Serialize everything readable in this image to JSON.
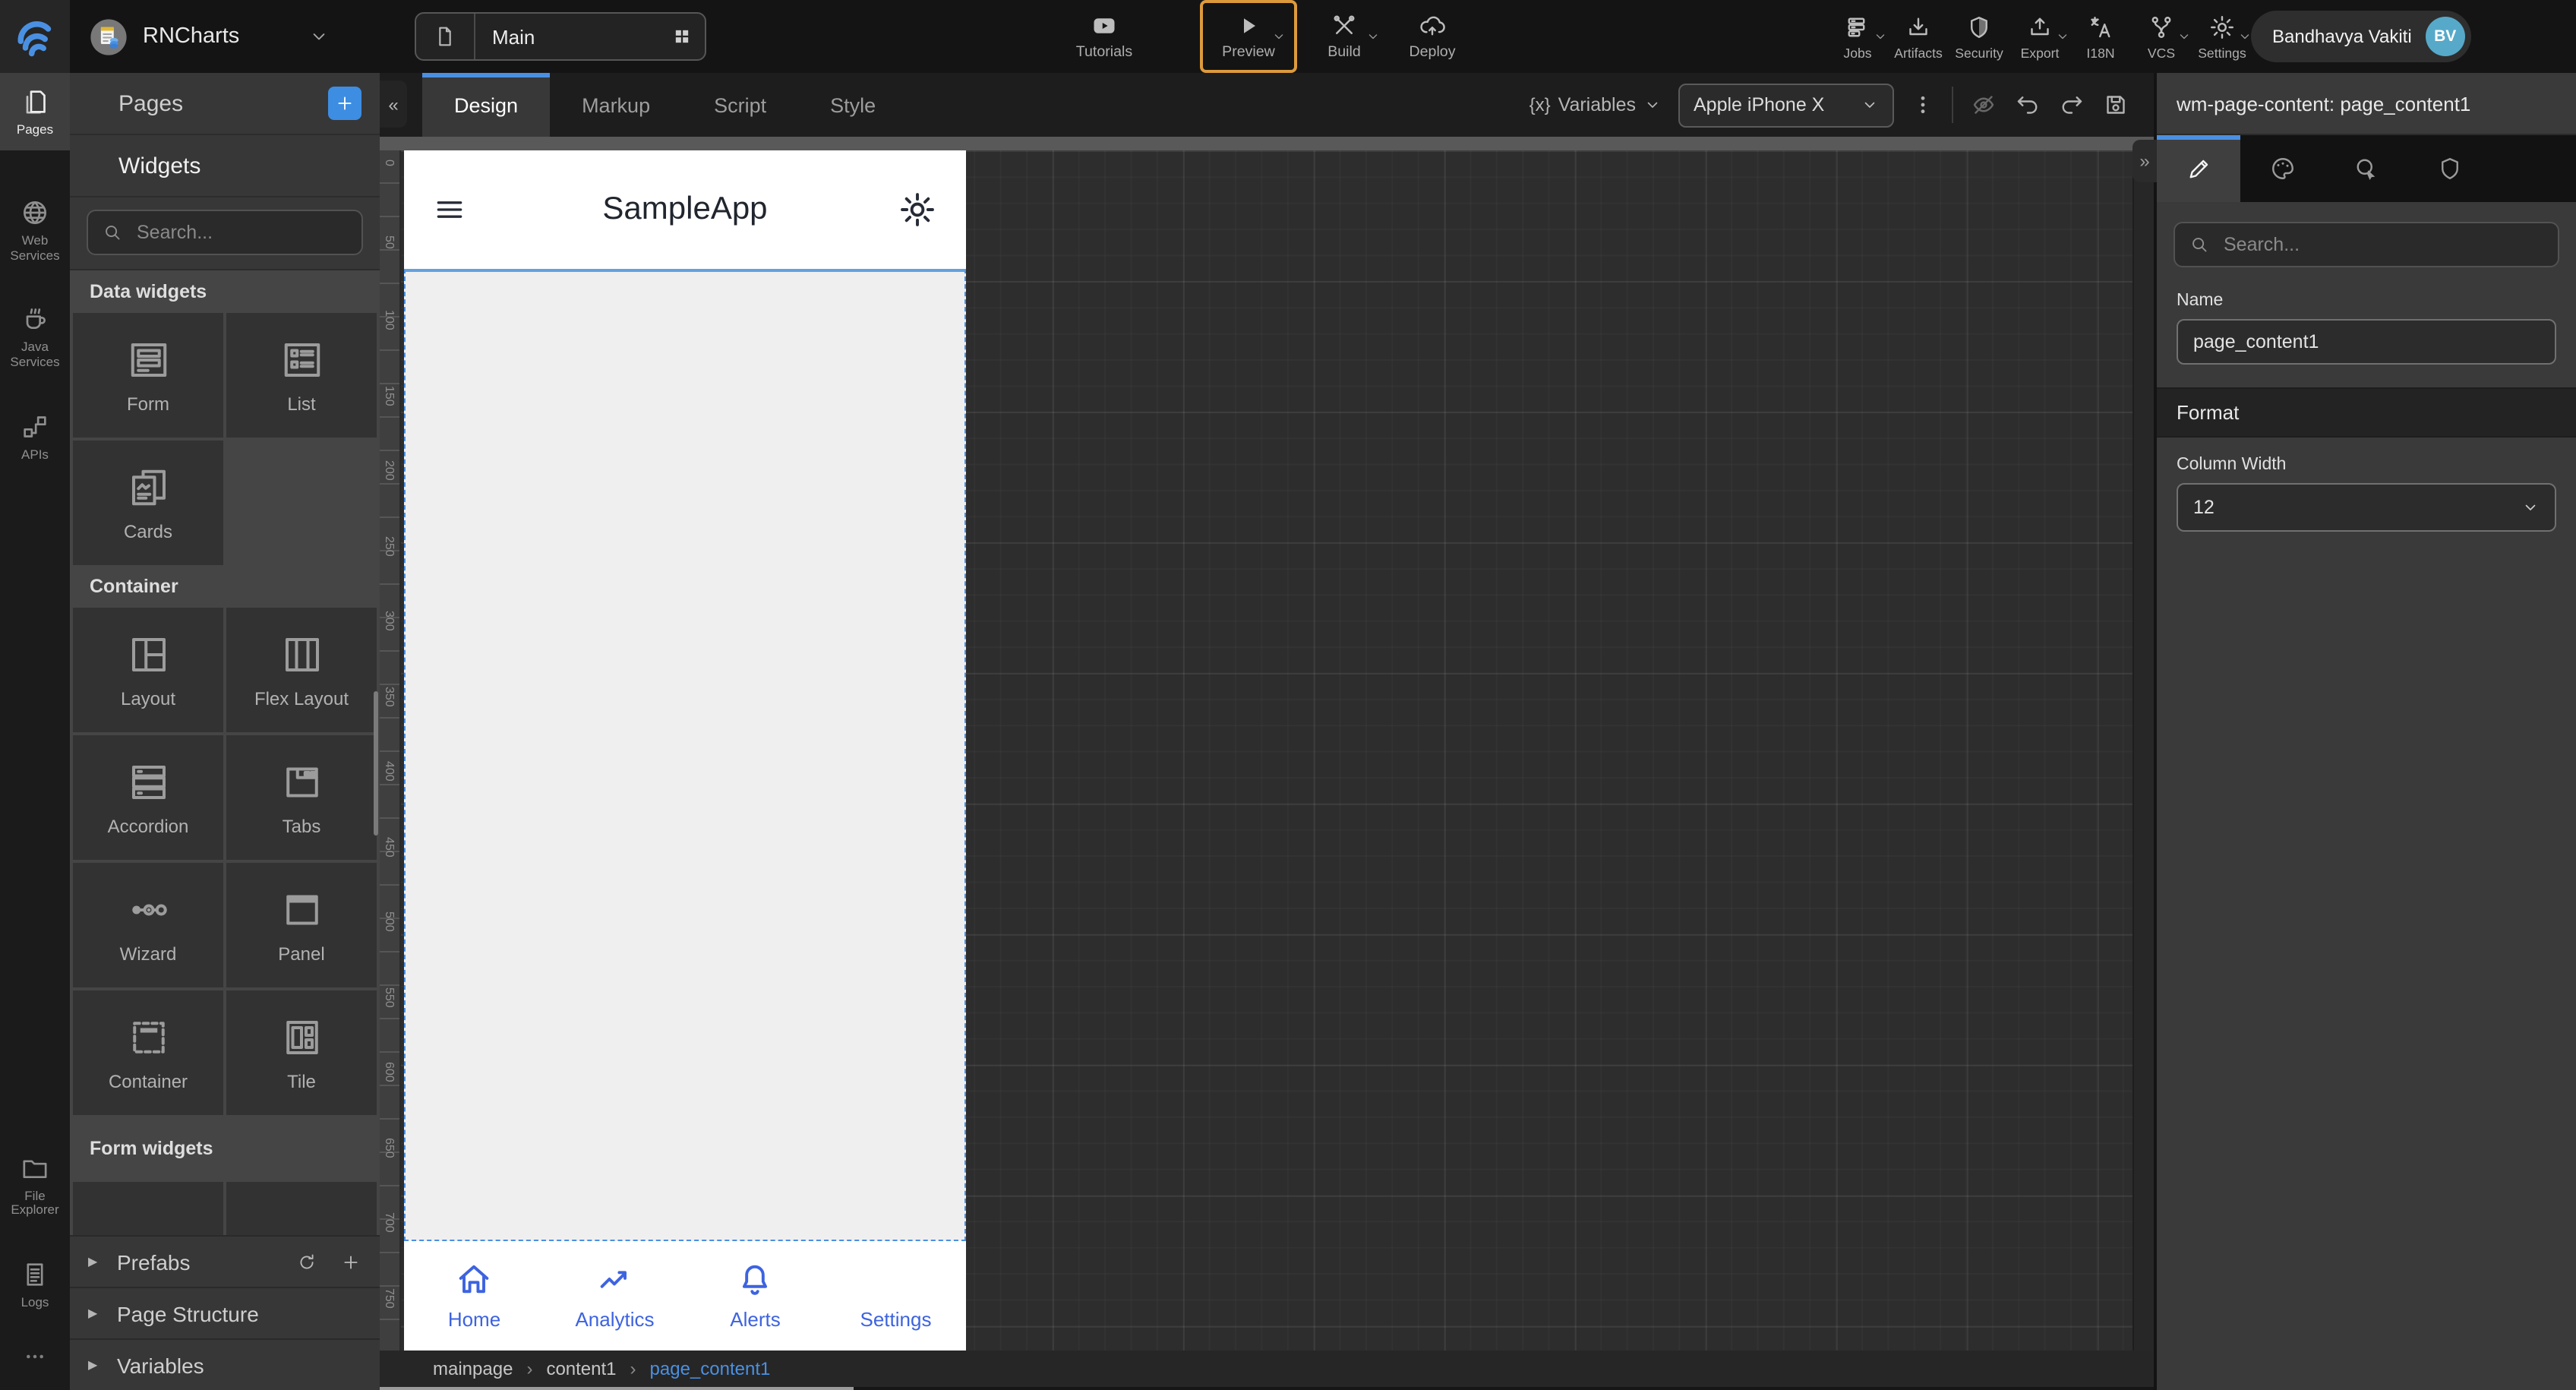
{
  "topbar": {
    "project_name": "RNCharts",
    "page_selector_value": "Main",
    "actions": [
      {
        "label": "Tutorials",
        "icon": "tutorials-icon",
        "chevron": false,
        "highlighted": false
      },
      {
        "label": "Preview",
        "icon": "play-icon",
        "chevron": true,
        "highlighted": true
      },
      {
        "label": "Build",
        "icon": "build-icon",
        "chevron": true,
        "highlighted": false
      },
      {
        "label": "Deploy",
        "icon": "deploy-icon",
        "chevron": false,
        "highlighted": false
      }
    ],
    "menus": [
      {
        "label": "Jobs",
        "icon": "jobs-icon",
        "chevron": true
      },
      {
        "label": "Artifacts",
        "icon": "artifacts-icon",
        "chevron": false
      },
      {
        "label": "Security",
        "icon": "security-icon",
        "chevron": false
      },
      {
        "label": "Export",
        "icon": "export-icon",
        "chevron": true
      },
      {
        "label": "I18N",
        "icon": "i18n-icon",
        "chevron": false
      },
      {
        "label": "VCS",
        "icon": "vcs-icon",
        "chevron": true
      },
      {
        "label": "Settings",
        "icon": "settings-icon",
        "chevron": true
      }
    ],
    "user": {
      "name": "Bandhavya Vakiti",
      "initials": "BV",
      "avatar_color": "#57a9c9"
    }
  },
  "left_rail": {
    "top_items": [
      {
        "label": "Pages",
        "icon": "pages-icon",
        "active": true
      },
      {
        "label": "Web Services",
        "icon": "web-services-icon",
        "active": false
      },
      {
        "label": "Java Services",
        "icon": "java-services-icon",
        "active": false
      },
      {
        "label": "APIs",
        "icon": "apis-icon",
        "active": false
      }
    ],
    "bottom_items": [
      {
        "label": "File Explorer",
        "icon": "file-explorer-icon"
      },
      {
        "label": "Logs",
        "icon": "logs-icon"
      }
    ]
  },
  "left_panel": {
    "pages_section_label": "Pages",
    "widgets_section_label": "Widgets",
    "search_placeholder": "Search...",
    "widget_groups": [
      {
        "title": "Data widgets",
        "widgets": [
          {
            "label": "Form",
            "icon": "form-widget-icon"
          },
          {
            "label": "List",
            "icon": "list-widget-icon"
          },
          {
            "label": "Cards",
            "icon": "cards-widget-icon"
          }
        ]
      },
      {
        "title": "Container",
        "widgets": [
          {
            "label": "Layout",
            "icon": "layout-widget-icon"
          },
          {
            "label": "Flex Layout",
            "icon": "flex-layout-widget-icon"
          },
          {
            "label": "Accordion",
            "icon": "accordion-widget-icon"
          },
          {
            "label": "Tabs",
            "icon": "tabs-widget-icon"
          },
          {
            "label": "Wizard",
            "icon": "wizard-widget-icon"
          },
          {
            "label": "Panel",
            "icon": "panel-widget-icon"
          },
          {
            "label": "Container",
            "icon": "container-widget-icon"
          },
          {
            "label": "Tile",
            "icon": "tile-widget-icon"
          }
        ]
      },
      {
        "title": "Form widgets",
        "widgets": [
          {
            "label": "",
            "icon": "partial-widget-icon"
          },
          {
            "label": "",
            "icon": "partial-widget-icon"
          }
        ]
      }
    ],
    "bottom_sections": [
      {
        "label": "Prefabs",
        "actions": [
          "refresh-icon",
          "plus-icon"
        ]
      },
      {
        "label": "Page Structure",
        "actions": []
      },
      {
        "label": "Variables",
        "actions": []
      }
    ]
  },
  "editor": {
    "tabs": [
      {
        "label": "Design",
        "active": true
      },
      {
        "label": "Markup",
        "active": false
      },
      {
        "label": "Script",
        "active": false
      },
      {
        "label": "Style",
        "active": false
      }
    ],
    "variables_label": "Variables",
    "device_value": "Apple iPhone X",
    "breadcrumb": [
      {
        "label": "mainpage",
        "active": false
      },
      {
        "label": "content1",
        "active": false
      },
      {
        "label": "page_content1",
        "active": true
      }
    ]
  },
  "canvas": {
    "app_title": "SampleApp",
    "ruler_labels": [
      "0",
      "50",
      "100",
      "150",
      "200",
      "250",
      "300",
      "350",
      "400",
      "450",
      "500",
      "550",
      "600",
      "650",
      "700",
      "750"
    ],
    "tabbar": [
      {
        "label": "Home",
        "icon": "home-icon"
      },
      {
        "label": "Analytics",
        "icon": "analytics-icon"
      },
      {
        "label": "Alerts",
        "icon": "alerts-icon"
      },
      {
        "label": "Settings",
        "icon": "settings-gear-icon"
      }
    ],
    "accent": "#3d63e0"
  },
  "right_panel": {
    "title": "wm-page-content: page_content1",
    "tabs": [
      "properties-pencil-icon",
      "styles-palette-icon",
      "events-cursor-icon",
      "security-shield-icon"
    ],
    "search_placeholder": "Search...",
    "fields": {
      "name_label": "Name",
      "name_value": "page_content1",
      "format_label": "Format",
      "column_width_label": "Column Width",
      "column_width_value": "12"
    }
  },
  "colors": {
    "accent_blue": "#4a90e2",
    "highlight_orange": "#dd9a3c",
    "phone_accent": "#3d63e0"
  }
}
